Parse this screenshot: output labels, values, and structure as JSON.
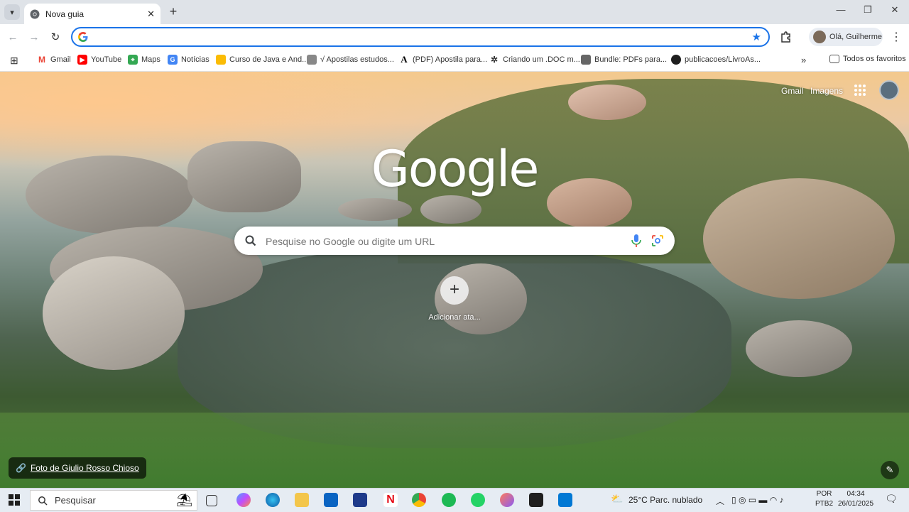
{
  "browser": {
    "tab": {
      "title": "Nova guia"
    },
    "omnibox": {
      "value": "",
      "placeholder": ""
    },
    "profile_label": "Olá, Guilherme",
    "bookmarks": [
      {
        "label": "Gmail",
        "icon": "gmail-icon"
      },
      {
        "label": "YouTube",
        "icon": "youtube-icon"
      },
      {
        "label": "Maps",
        "icon": "maps-icon"
      },
      {
        "label": "Notícias",
        "icon": "news-icon"
      },
      {
        "label": "Curso de Java e And...",
        "icon": "bookmark-icon"
      },
      {
        "label": "√ Apostilas estudos...",
        "icon": "bookmark-icon"
      },
      {
        "label": "(PDF) Apostila para...",
        "icon": "bookmark-icon"
      },
      {
        "label": "Criando um .DOC m...",
        "icon": "bookmark-icon"
      },
      {
        "label": "Bundle: PDFs para...",
        "icon": "bookmark-icon"
      },
      {
        "label": "publicacoes/LivroAs...",
        "icon": "github-icon"
      }
    ],
    "all_bookmarks_label": "Todos os favoritos"
  },
  "newtab": {
    "top_links": {
      "gmail": "Gmail",
      "images": "Imagens"
    },
    "logo": "Google",
    "search_placeholder": "Pesquise no Google ou digite um URL",
    "shortcut_label": "Adicionar ata...",
    "photo_credit": "Foto de Giulio Rosso Chioso"
  },
  "taskbar": {
    "search_label": "Pesquisar",
    "weather": "25°C  Parc. nublado",
    "lang_top": "POR",
    "lang_bottom": "PTB2",
    "time": "04:34",
    "date": "26/01/2025"
  },
  "colors": {
    "accent": "#1a73e8",
    "tab_strip": "#dfe3e8",
    "taskbar": "#e6ecf3"
  }
}
